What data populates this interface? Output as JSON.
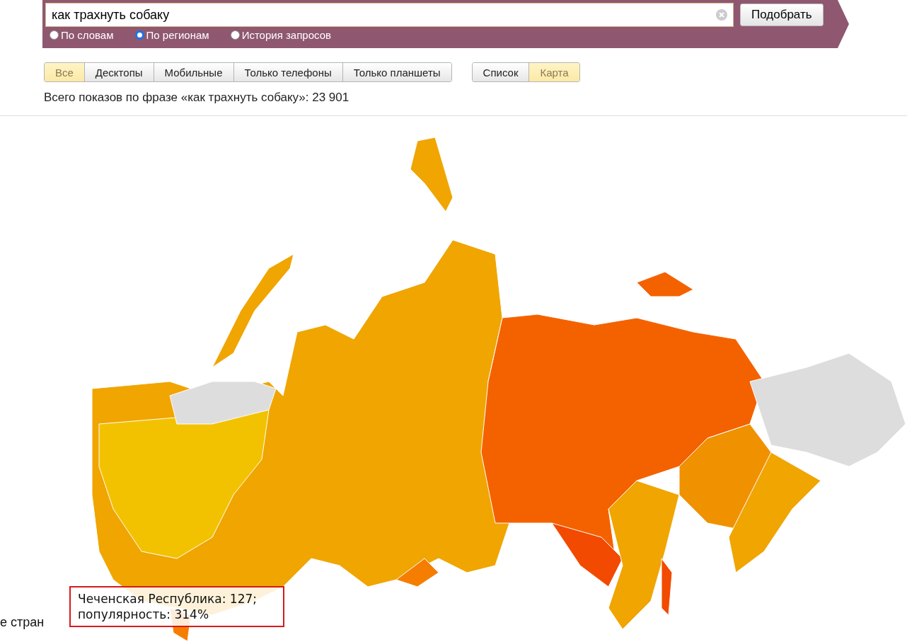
{
  "search": {
    "value": "как трахнуть собаку",
    "button": "Подобрать"
  },
  "modes": [
    {
      "label": "По словам",
      "selected": false
    },
    {
      "label": "По регионам",
      "selected": true
    },
    {
      "label": "История запросов",
      "selected": false
    }
  ],
  "devices": [
    {
      "label": "Все",
      "selected": true
    },
    {
      "label": "Десктопы",
      "selected": false
    },
    {
      "label": "Мобильные",
      "selected": false
    },
    {
      "label": "Только телефоны",
      "selected": false
    },
    {
      "label": "Только планшеты",
      "selected": false
    }
  ],
  "views": [
    {
      "label": "Список",
      "selected": false
    },
    {
      "label": "Карта",
      "selected": true
    }
  ],
  "total": "Всего показов по фразе «как трахнуть собаку»: 23 901",
  "tooltip": {
    "line_1": "Чеченская Республика: 127;",
    "line_2": "популярность: 314%"
  },
  "side_text": "е стран"
}
